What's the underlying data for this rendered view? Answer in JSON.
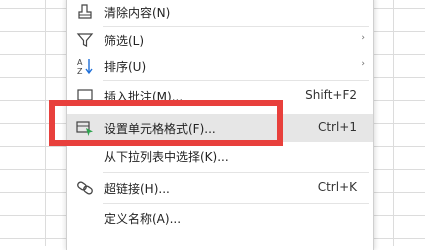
{
  "context_menu": {
    "items": [
      {
        "label": "清除内容(N)",
        "shortcut": "",
        "icon": "eraser-icon",
        "has_submenu": false
      },
      {
        "label": "筛选(L)",
        "shortcut": "",
        "icon": "filter-icon",
        "has_submenu": true
      },
      {
        "label": "排序(U)",
        "shortcut": "",
        "icon": "sort-az-icon",
        "has_submenu": true
      },
      {
        "label": "插入批注(M)...",
        "shortcut": "Shift+F2",
        "icon": "comment-icon",
        "has_submenu": false
      },
      {
        "label": "设置单元格格式(F)...",
        "shortcut": "Ctrl+1",
        "icon": "format-cells-icon",
        "has_submenu": false
      },
      {
        "label": "从下拉列表中选择(K)...",
        "shortcut": "",
        "icon": "",
        "has_submenu": false
      },
      {
        "label": "超链接(H)...",
        "shortcut": "Ctrl+K",
        "icon": "link-icon",
        "has_submenu": false
      },
      {
        "label": "定义名称(A)...",
        "shortcut": "",
        "icon": "",
        "has_submenu": false
      }
    ],
    "submenu_arrow": "›"
  },
  "colors": {
    "highlight_box": "#e8403c",
    "hover_background": "#e6e6e6",
    "format_icon_accent": "#2ea44f"
  }
}
